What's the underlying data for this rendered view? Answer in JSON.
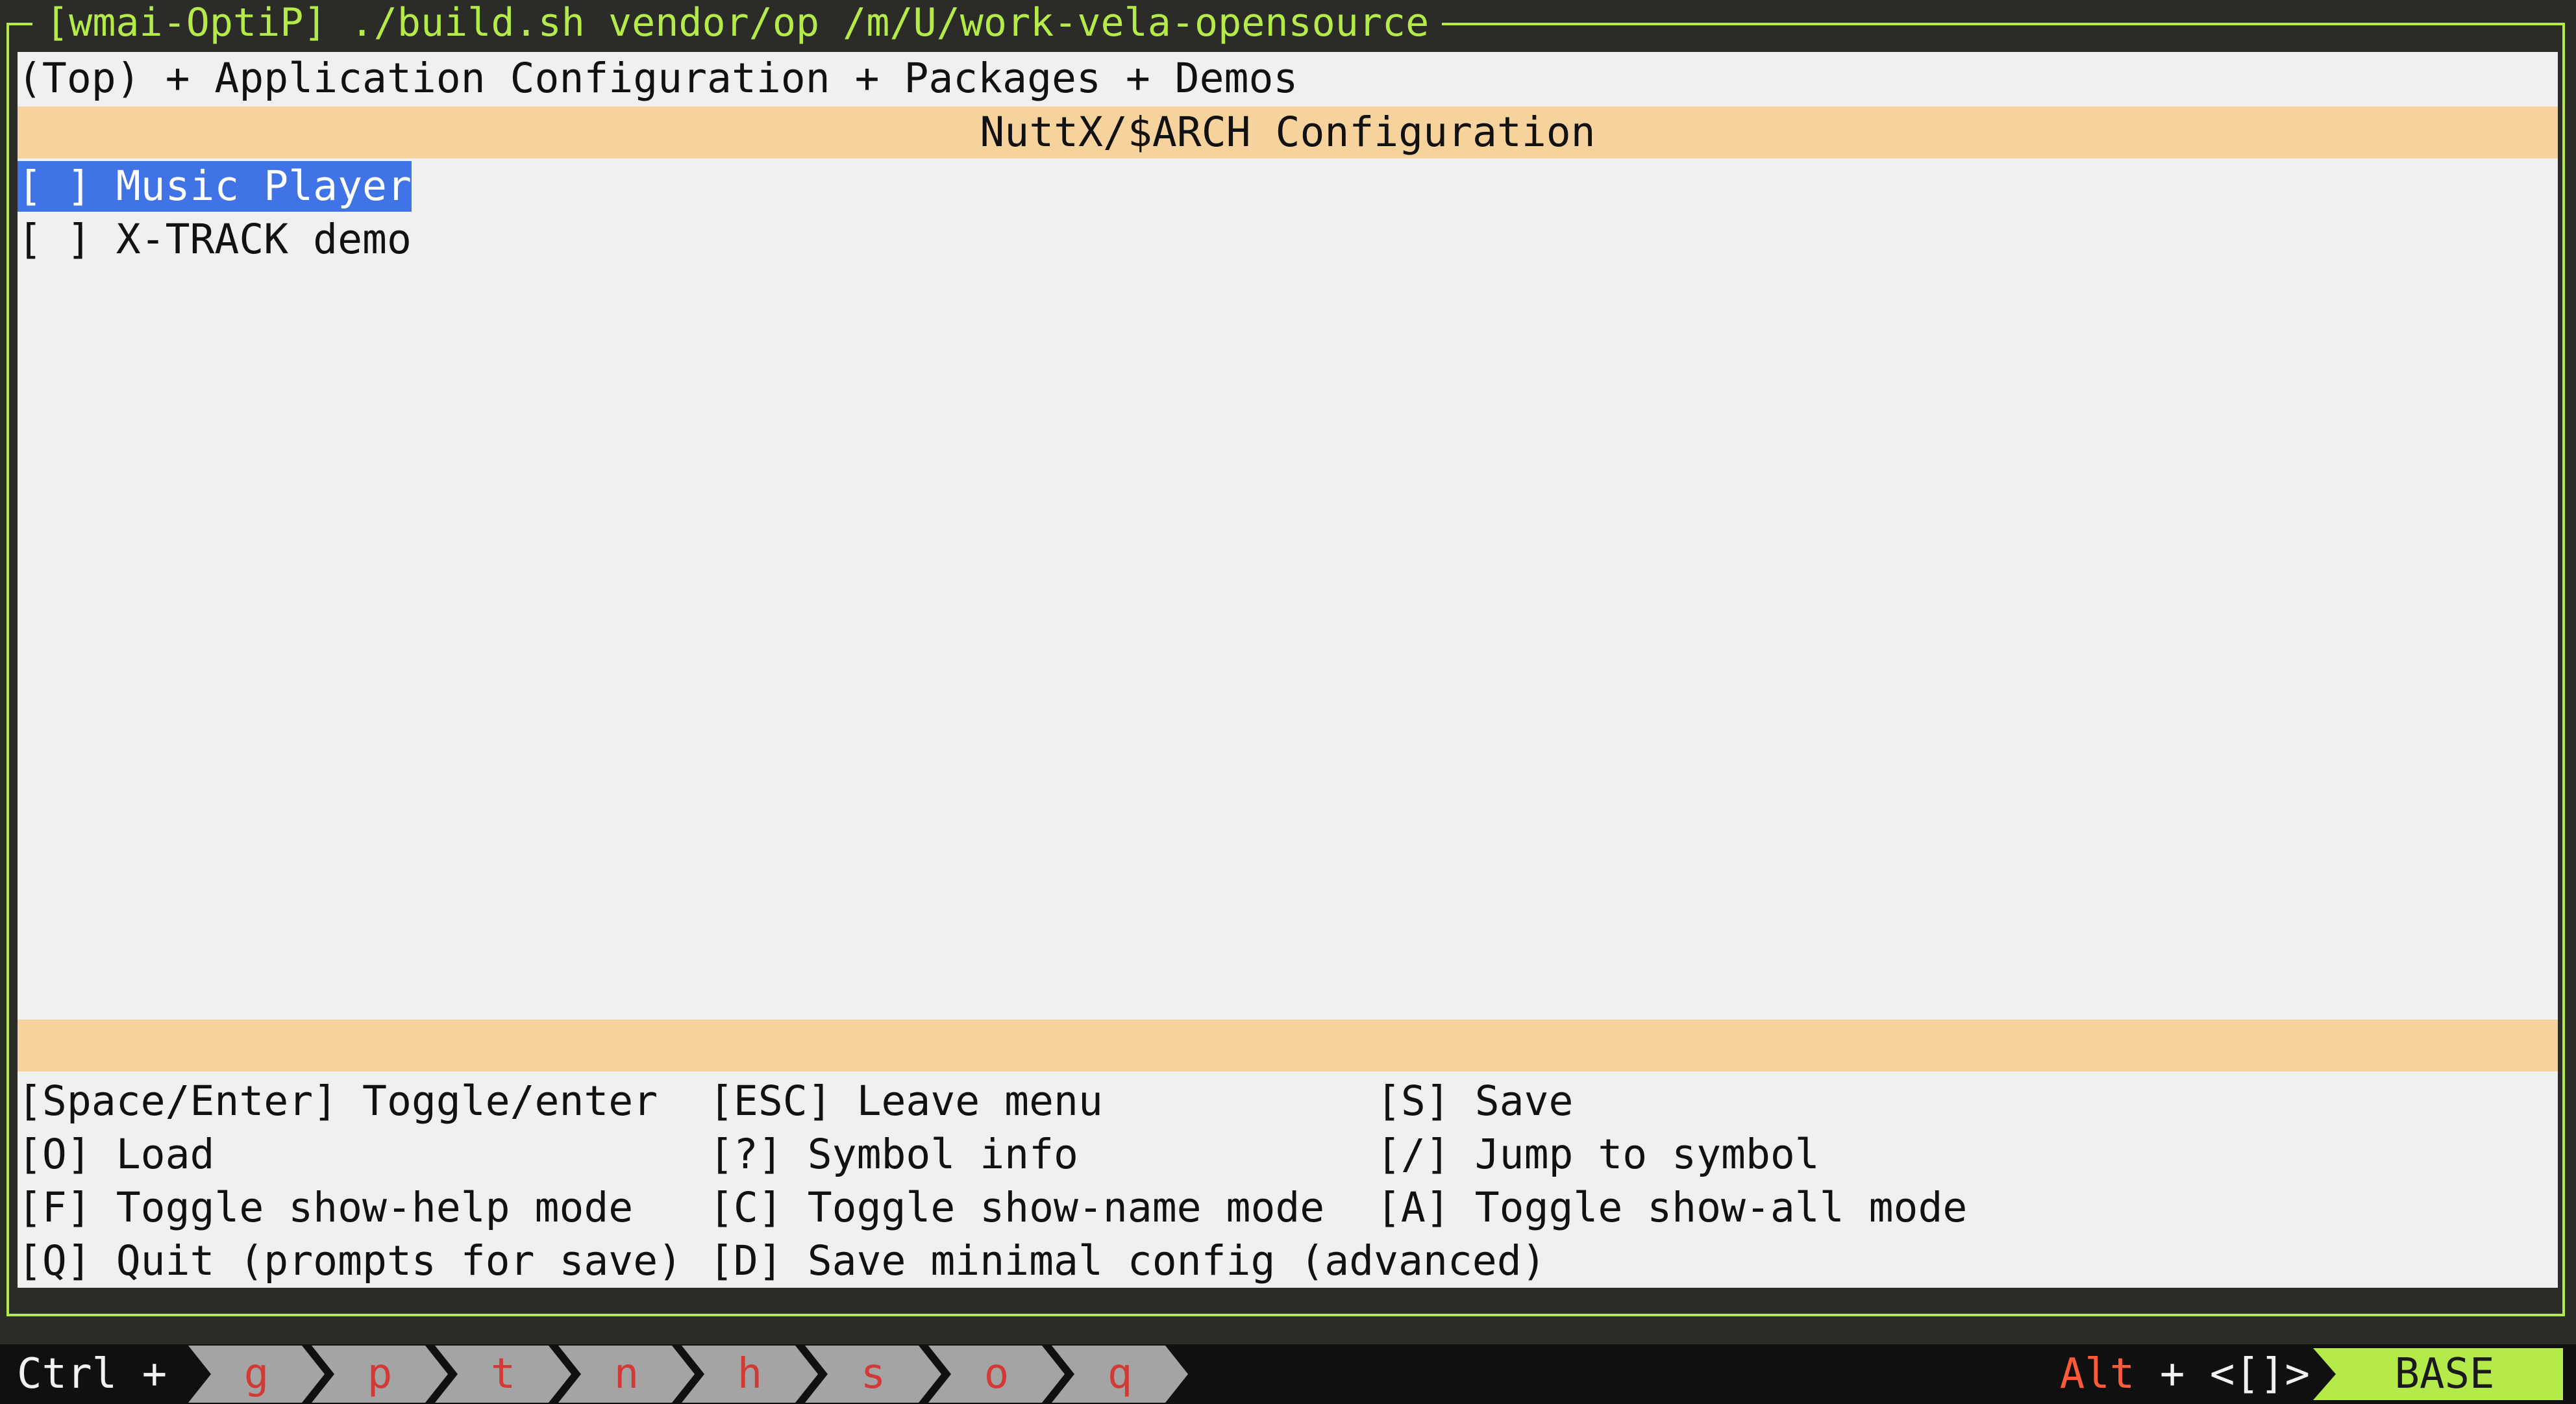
{
  "pane": {
    "title": "[wmai-OptiP] ./build.sh vendor/op /m/U/work-vela-opensource"
  },
  "menu": {
    "breadcrumb": "(Top) + Application Configuration + Packages + Demos",
    "header": "NuttX/$ARCH Configuration",
    "items": [
      {
        "text": "[ ] Music Player",
        "selected": true
      },
      {
        "text": "[ ] X-TRACK demo",
        "selected": false
      }
    ]
  },
  "help": {
    "rows": [
      [
        "[Space/Enter] Toggle/enter",
        "[ESC] Leave menu",
        "[S] Save"
      ],
      [
        "[O] Load",
        "[?] Symbol info",
        "[/] Jump to symbol"
      ],
      [
        "[F] Toggle show-help mode",
        "[C] Toggle show-name mode",
        "[A] Toggle show-all mode"
      ],
      [
        "[Q] Quit (prompts for save)",
        "[D] Save minimal config (advanced)",
        ""
      ]
    ]
  },
  "status_bar": {
    "ctrl_label": "Ctrl +",
    "keys": [
      "g",
      "p",
      "t",
      "n",
      "h",
      "s",
      "o",
      "q"
    ],
    "alt_label": "Alt",
    "alt_plus": "+",
    "alt_bracket": "<[]>",
    "mode": "BASE"
  },
  "colors": {
    "frame": "#b4ea49",
    "header_band": "#f6d29d",
    "selection": "#3f73e6",
    "key_bg": "#a4a4a4",
    "key_text": "#d13a35",
    "alt_text": "#ff5b38"
  }
}
